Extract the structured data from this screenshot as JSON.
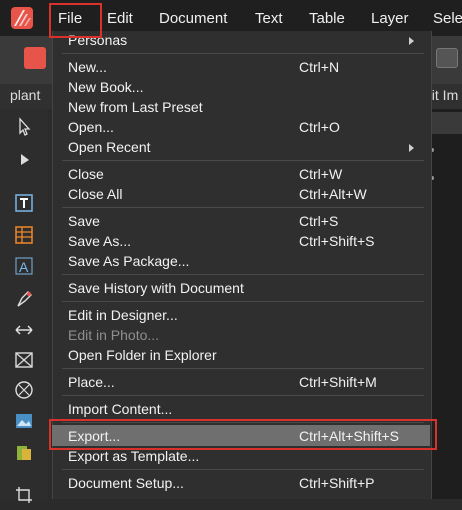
{
  "menubar": {
    "items": [
      "File",
      "Edit",
      "Document",
      "Text",
      "Table",
      "Layer",
      "Selec"
    ]
  },
  "tabs": {
    "left": "plant",
    "right": "dit Im"
  },
  "file_menu": {
    "personas": "Personas",
    "new": {
      "label": "New...",
      "shortcut": "Ctrl+N"
    },
    "new_book": "New Book...",
    "new_from_preset": "New from Last Preset",
    "open": {
      "label": "Open...",
      "shortcut": "Ctrl+O"
    },
    "open_recent": "Open Recent",
    "close": {
      "label": "Close",
      "shortcut": "Ctrl+W"
    },
    "close_all": {
      "label": "Close All",
      "shortcut": "Ctrl+Alt+W"
    },
    "save": {
      "label": "Save",
      "shortcut": "Ctrl+S"
    },
    "save_as": {
      "label": "Save As...",
      "shortcut": "Ctrl+Shift+S"
    },
    "save_as_package": "Save As Package...",
    "save_history": "Save History with Document",
    "edit_in_designer": "Edit in Designer...",
    "edit_in_photo": "Edit in Photo...",
    "open_folder": "Open Folder in Explorer",
    "place": {
      "label": "Place...",
      "shortcut": "Ctrl+Shift+M"
    },
    "import_content": "Import Content...",
    "export": {
      "label": "Export...",
      "shortcut": "Ctrl+Alt+Shift+S"
    },
    "export_template": "Export as Template...",
    "document_setup": {
      "label": "Document Setup...",
      "shortcut": "Ctrl+Shift+P"
    }
  },
  "colors": {
    "highlight": "#6f6f6f",
    "annotation_red": "#d9322b",
    "menu_bg": "#2f2f2f"
  }
}
